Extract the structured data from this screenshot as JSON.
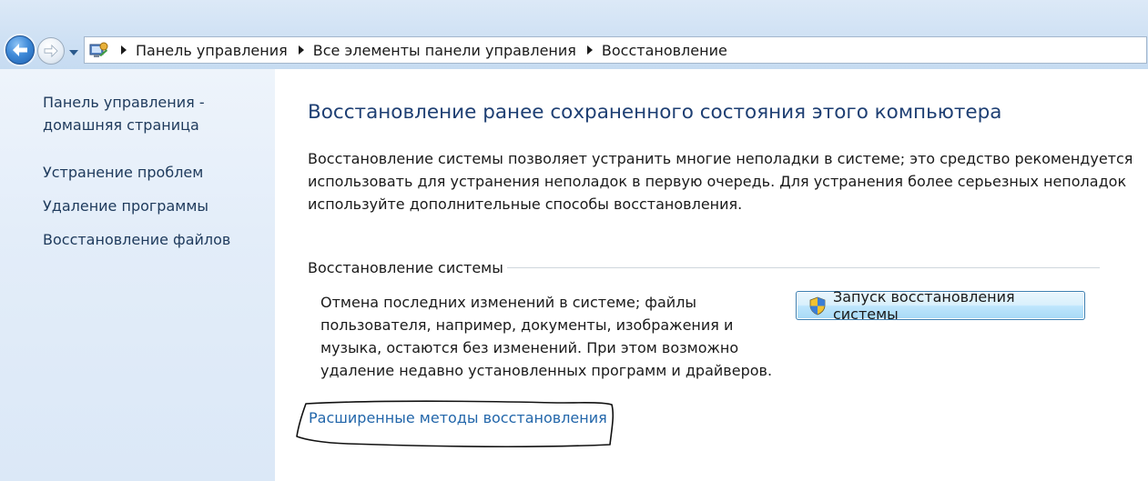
{
  "navigation": {
    "breadcrumbs": [
      "Панель управления",
      "Все элементы панели управления",
      "Восстановление"
    ]
  },
  "sidebar": {
    "home_line1": "Панель управления -",
    "home_line2": "домашняя страница",
    "links": [
      "Устранение проблем",
      "Удаление программы",
      "Восстановление файлов"
    ]
  },
  "main": {
    "title": "Восстановление ранее сохраненного состояния этого компьютера",
    "description_lines": [
      "Восстановление системы позволяет устранить многие неполадки в системе; это средство рекомендуется",
      "использовать для устранения неполадок в первую очередь. Для устранения более серьезных неполадок",
      "используйте дополнительные способы восстановления."
    ],
    "group_label": "Восстановление системы",
    "restore_text_lines": [
      "Отмена последних изменений в системе; файлы",
      "пользователя, например, документы, изображения и",
      "музыка, остаются без изменений. При этом возможно",
      "удаление недавно установленных программ и драйверов."
    ],
    "restore_button_label": "Запуск восстановления системы",
    "advanced_link": "Расширенные методы восстановления"
  },
  "colors": {
    "title": "#1e3f73",
    "link": "#2266aa",
    "sidebar_link": "#1e3a5c"
  },
  "icons": [
    "back-arrow-icon",
    "forward-arrow-icon",
    "dropdown-arrow-icon",
    "control-panel-icon",
    "uac-shield-icon"
  ]
}
